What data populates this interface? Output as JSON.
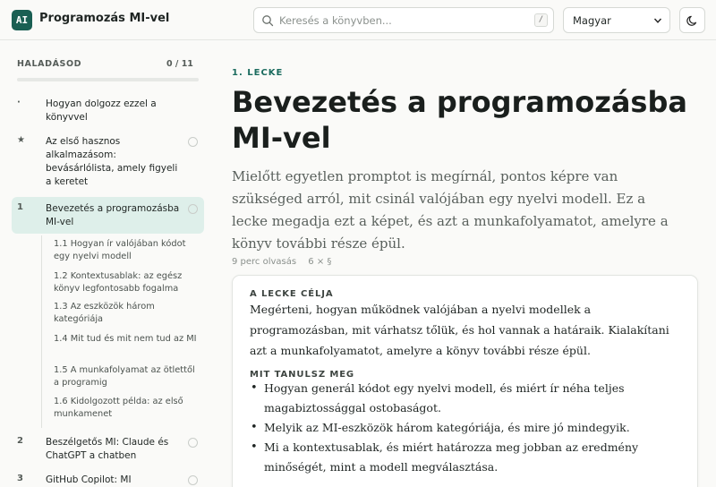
{
  "header": {
    "logo_text": "AI",
    "app_title": "Programozás MI-vel",
    "search_placeholder": "Keresés a könyvben...",
    "search_shortcut": "/",
    "language": "Magyar"
  },
  "sidebar": {
    "progress_label": "HALADÁSOD",
    "progress_count": "0 / 11",
    "progress_fraction": 0,
    "chapters": [
      {
        "num": "·",
        "title": "Hogyan dolgozz ezzel a könyvvel"
      },
      {
        "num": "★",
        "title": "Az első hasznos alkalmazásom: bevásárlólista, amely figyeli a keretet"
      },
      {
        "num": "1",
        "title": "Bevezetés a programozásba MI-vel"
      },
      {
        "num": "2",
        "title": "Beszélgetős MI: Claude és ChatGPT a chatben"
      },
      {
        "num": "3",
        "title": "GitHub Copilot: MI"
      }
    ],
    "subsections": [
      "1.1  Hogyan ír valójában kódot egy nyelvi modell",
      "1.2  Kontextusablak: az egész könyv legfontosabb fogalma",
      "1.3  Az eszközök három kategóriája",
      "1.4  Mit tud és mit nem tud az MI",
      "1.5  A munkafolyamat az ötlettől a programig",
      "1.6  Kidolgozott példa: az első munkamenet"
    ]
  },
  "main": {
    "kicker": "1. LECKE",
    "title": "Bevezetés a programozásba MI-vel",
    "intro": "Mielőtt egyetlen promptot is megírnál, pontos képre van szükséged arról, mit csinál valójában egy nyelvi modell. Ez a lecke megadja ezt a képet, és azt a munkafolyamatot, amelyre a könyv további része épül.",
    "reading_time": "9 perc olvasás",
    "section_count": "6 × §",
    "goal_heading": "A LECKE CÉLJA",
    "goal_text": "Megérteni, hogyan működnek valójában a nyelvi modellek a programozásban, mit várhatsz tőlük, és hol vannak a határaik. Kialakítani azt a munkafolyamatot, amelyre a könyv további része épül.",
    "learn_heading": "MIT TANULSZ MEG",
    "learn_items": [
      "Hogyan generál kódot egy nyelvi modell, és miért ír néha teljes magabiztossággal ostobaságot.",
      "Melyik az MI-eszközök három kategóriája, és mire jó mindegyik.",
      "Mi a kontextusablak, és miért határozza meg jobban az eredmény minőségét, mint a modell megválasztása."
    ]
  }
}
